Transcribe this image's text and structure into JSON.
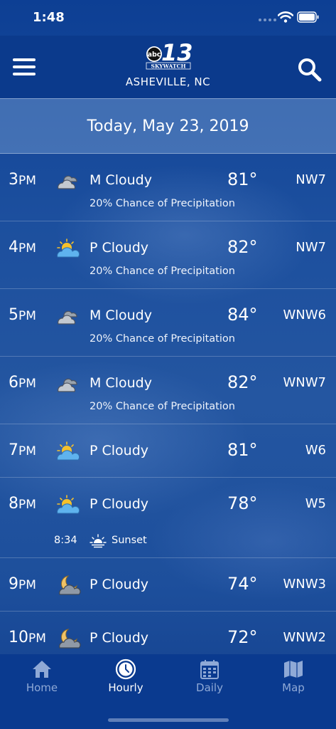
{
  "status_bar": {
    "time": "1:48"
  },
  "header": {
    "logo_number": "13",
    "logo_brand": "abc",
    "logo_sub": "SKYWATCH",
    "location": "ASHEVILLE, NC"
  },
  "date_banner": "Today, May 23, 2019",
  "hours": [
    {
      "hour": "3",
      "ampm": "PM",
      "icon": "mostly-cloudy-icon",
      "condition": "M Cloudy",
      "temp": "81°",
      "wind": "NW7",
      "precip": "20% Chance of Precipitation"
    },
    {
      "hour": "4",
      "ampm": "PM",
      "icon": "partly-cloudy-day-icon",
      "condition": "P Cloudy",
      "temp": "82°",
      "wind": "NW7",
      "precip": "20% Chance of Precipitation"
    },
    {
      "hour": "5",
      "ampm": "PM",
      "icon": "mostly-cloudy-icon",
      "condition": "M Cloudy",
      "temp": "84°",
      "wind": "WNW6",
      "precip": "20% Chance of Precipitation"
    },
    {
      "hour": "6",
      "ampm": "PM",
      "icon": "mostly-cloudy-icon",
      "condition": "M Cloudy",
      "temp": "82°",
      "wind": "WNW7",
      "precip": "20% Chance of Precipitation"
    },
    {
      "hour": "7",
      "ampm": "PM",
      "icon": "partly-cloudy-day-icon",
      "condition": "P Cloudy",
      "temp": "81°",
      "wind": "W6"
    },
    {
      "hour": "8",
      "ampm": "PM",
      "icon": "partly-cloudy-day-icon",
      "condition": "P Cloudy",
      "temp": "78°",
      "wind": "W5",
      "sunset_time": "8:34",
      "sunset_label": "Sunset"
    },
    {
      "hour": "9",
      "ampm": "PM",
      "icon": "partly-cloudy-night-icon",
      "condition": "P Cloudy",
      "temp": "74°",
      "wind": "WNW3"
    },
    {
      "hour": "10",
      "ampm": "PM",
      "icon": "partly-cloudy-night-icon",
      "condition": "P Cloudy",
      "temp": "72°",
      "wind": "WNW2"
    }
  ],
  "tabs": [
    {
      "label": "Home",
      "icon": "home-icon"
    },
    {
      "label": "Hourly",
      "icon": "clock-icon"
    },
    {
      "label": "Daily",
      "icon": "calendar-icon"
    },
    {
      "label": "Map",
      "icon": "map-icon"
    }
  ],
  "colors": {
    "background": "#0b3e93",
    "tab_inactive": "#8fa9d6",
    "sun": "#f6c12b",
    "cloud_day": "#5fb3ee"
  }
}
